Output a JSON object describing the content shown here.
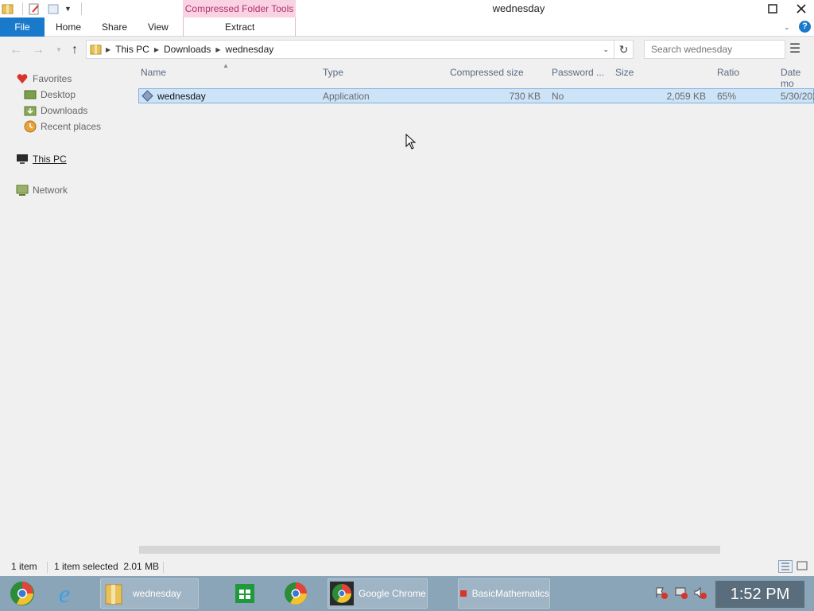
{
  "window": {
    "title": "wednesday",
    "context_tab": "Compressed Folder Tools"
  },
  "ribbon": {
    "tabs": [
      "File",
      "Home",
      "Share",
      "View",
      "Extract"
    ]
  },
  "address": {
    "crumbs": [
      "This PC",
      "Downloads",
      "wednesday"
    ],
    "search_placeholder": "Search wednesday"
  },
  "navpane": {
    "favorites": "Favorites",
    "desktop": "Desktop",
    "downloads": "Downloads",
    "recent": "Recent places",
    "thispc": "This PC",
    "network": "Network"
  },
  "columns": {
    "name": "Name",
    "type": "Type",
    "compressed": "Compressed size",
    "password": "Password ...",
    "size": "Size",
    "ratio": "Ratio",
    "date": "Date mo"
  },
  "files": [
    {
      "name": "wednesday",
      "type": "Application",
      "compressed": "730 KB",
      "password": "No",
      "size": "2,059 KB",
      "ratio": "65%",
      "date": "5/30/202"
    }
  ],
  "status": {
    "count": "1 item",
    "selected": "1 item selected  2.01 MB"
  },
  "taskbar": {
    "explorer": "wednesday",
    "chrome": "Google Chrome",
    "app": "BasicMathematics",
    "clock": "1:52 PM"
  }
}
